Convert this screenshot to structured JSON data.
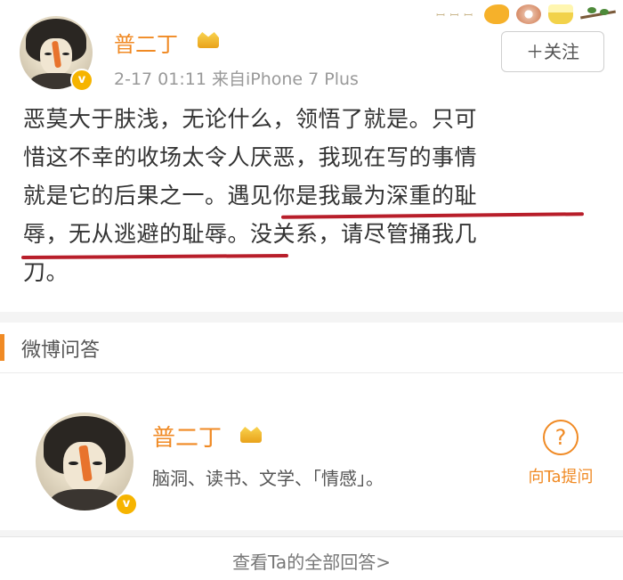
{
  "post": {
    "username": "普二丁",
    "meta": "2-17 01:11  来自iPhone 7 Plus",
    "follow_label": "＋关注",
    "verified_mark": "v",
    "sticker_text": "ꟷ ꟷ ꟷ",
    "body_lines": [
      "恶莫大于肤浅，无论什么，领悟了就是。只可",
      "惜这不幸的收场太令人厌恶，我现在写的事情",
      "就是它的后果之一。遇见你是我最为深重的耻",
      "辱，无从逃避的耻辱。没关系，请尽管捅我几",
      "刀。"
    ],
    "underline_color": "#b81e2a"
  },
  "qa": {
    "section_title": "微博问答",
    "username": "普二丁",
    "verified_mark": "v",
    "tags": "脑洞、读书、文学、「情感」。",
    "ask_icon": "?",
    "ask_label": "向Ta提问",
    "all_answers_link": "查看Ta的全部回答>"
  },
  "colors": {
    "accent_orange": "#f08a24",
    "verified_gold": "#f6b400"
  },
  "icons": {
    "crown": "member-crown-icon",
    "verified": "verified-badge-icon",
    "ask": "question-circle-icon"
  }
}
